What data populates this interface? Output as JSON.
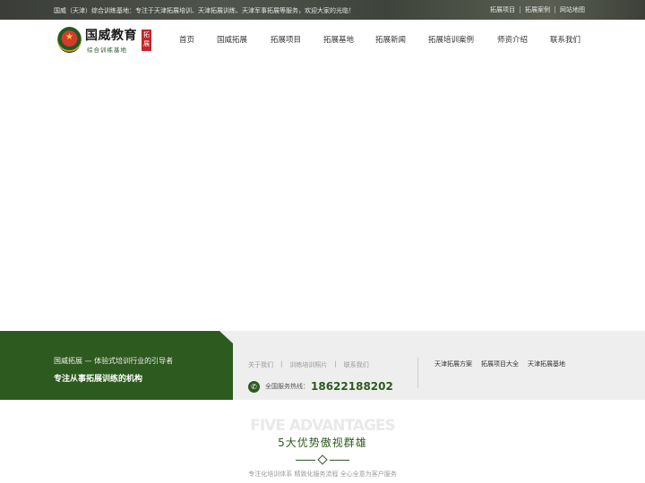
{
  "topbar": {
    "welcome": "国威（天津）综合训练基地：专注于天津拓展培训、天津拓展训练、天津军事拓展等服务，欢迎大家的光临！",
    "links": [
      "拓展项目",
      "拓展案例",
      "网站地图"
    ]
  },
  "logo": {
    "title": "国威教育",
    "subtitle": "综合训练基地",
    "tag": "拓展",
    "emblem_icon": "star-emblem-icon"
  },
  "nav": {
    "items": [
      "首页",
      "国威拓展",
      "拓展项目",
      "拓展基地",
      "拓展新闻",
      "拓展培训案例",
      "师资介绍",
      "联系我们"
    ]
  },
  "info": {
    "slogan_line1": "国威拓展 — 体验式培训行业的引导者",
    "slogan_line2": "专注从事拓展训练的机构",
    "quick_links": [
      "关于我们",
      "训练培训照片",
      "联系我们"
    ],
    "hotline_label": "全国服务热线：",
    "hotline_number": "18622188202",
    "right_links": [
      "天津拓展方案",
      "拓展项目大全",
      "天津拓展基地"
    ]
  },
  "advantages": {
    "english": "FIVE ADVANTAGES",
    "title": "5大优势傲视群雄",
    "description": "专注化培训体系 精致化服务流程 全心全意为客户服务"
  },
  "colors": {
    "brand_green": "#2d5a1e",
    "brand_red": "#c0262a",
    "topbar_bg": "#4a4e45",
    "info_bg": "#eeeeee"
  }
}
